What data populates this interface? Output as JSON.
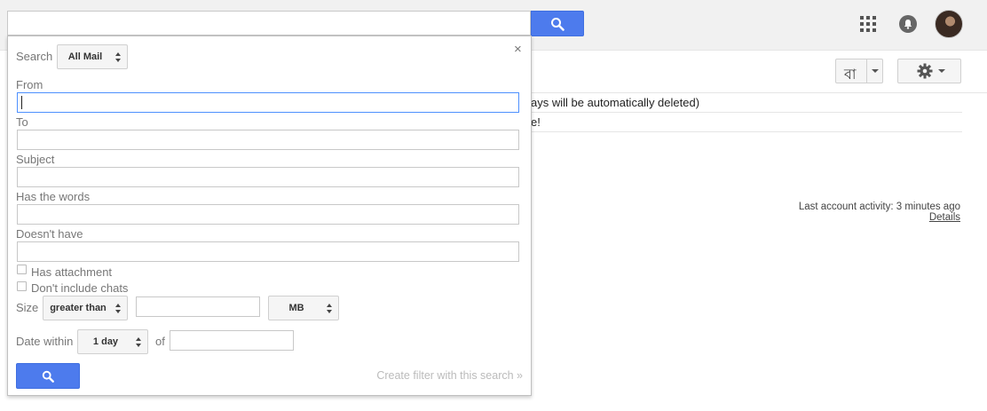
{
  "header": {
    "apps_icon": "apps-grid-icon",
    "notifications_icon": "bell-icon",
    "avatar_icon": "avatar-icon"
  },
  "toolbar": {
    "language_label": "বা",
    "settings_icon": "gear-icon"
  },
  "mail_list": {
    "line_a": "ays will be automatically deleted)",
    "line_b": "e!"
  },
  "activity": {
    "text": "Last account activity: 3 minutes ago",
    "details": "Details"
  },
  "search_panel": {
    "search_label": "Search",
    "scope_value": "All Mail",
    "close": "×",
    "from_label": "From",
    "to_label": "To",
    "subject_label": "Subject",
    "has_words_label": "Has the words",
    "doesnt_have_label": "Doesn't have",
    "has_attachment_label": "Has attachment",
    "no_chats_label": "Don't include chats",
    "size_label": "Size",
    "size_operator": "greater than",
    "size_unit": "MB",
    "date_label": "Date within",
    "date_value": "1 day",
    "of_label": "of",
    "create_filter": "Create filter with this search »",
    "colors": {
      "accent": "#4d7bed",
      "focus": "#4d90fe"
    }
  }
}
